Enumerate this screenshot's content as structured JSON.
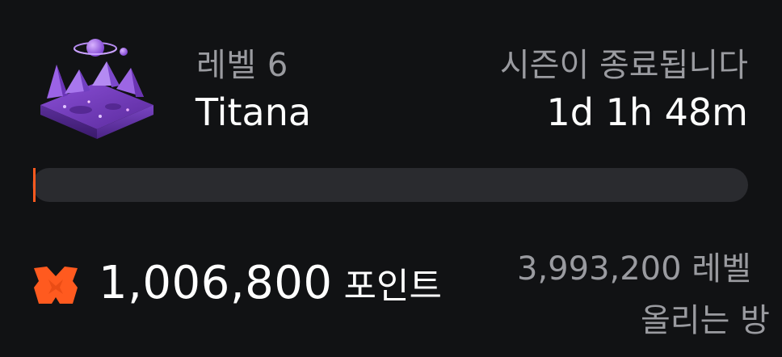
{
  "level": {
    "label": "레벨 6",
    "name": "Titana",
    "art_icon": "purple-planet-island-icon"
  },
  "season": {
    "label": "시즌이 종료됩니다",
    "countdown": "1d 1h 48m"
  },
  "progress": {
    "fraction": 0.0,
    "track_color": "#2a2b2f",
    "fill_color": "#ff5a1f"
  },
  "points": {
    "icon": "orange-x-points-icon",
    "value": "1,006,800",
    "unit": "포인트"
  },
  "next_level": {
    "amount": "3,993,200 레벨",
    "caption": "올리는 방"
  },
  "colors": {
    "background": "#111214",
    "accent": "#ff5a1f",
    "muted_text": "#9a9ba0",
    "primary_text": "#ffffff"
  }
}
